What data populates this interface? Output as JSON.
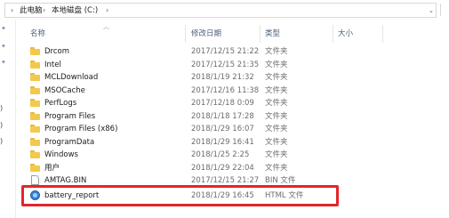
{
  "address": {
    "this_pc": "此电脑",
    "drive": "本地磁盘 (C:)"
  },
  "columns": {
    "name": "名称",
    "date": "修改日期",
    "type": "类型",
    "size": "大小"
  },
  "rows": [
    {
      "name": "Drcom",
      "date": "2017/12/15 21:22",
      "type": "文件夹",
      "size": "",
      "icon": "folder-icon"
    },
    {
      "name": "Intel",
      "date": "2017/12/15 21:35",
      "type": "文件夹",
      "size": "",
      "icon": "folder-icon"
    },
    {
      "name": "MCLDownload",
      "date": "2018/1/19 21:32",
      "type": "文件夹",
      "size": "",
      "icon": "folder-icon"
    },
    {
      "name": "MSOCache",
      "date": "2017/12/16 11:38",
      "type": "文件夹",
      "size": "",
      "icon": "folder-icon"
    },
    {
      "name": "PerfLogs",
      "date": "2017/12/18 0:09",
      "type": "文件夹",
      "size": "",
      "icon": "folder-icon"
    },
    {
      "name": "Program Files",
      "date": "2018/1/18 17:28",
      "type": "文件夹",
      "size": "",
      "icon": "folder-icon"
    },
    {
      "name": "Program Files (x86)",
      "date": "2018/1/29 16:07",
      "type": "文件夹",
      "size": "",
      "icon": "folder-icon"
    },
    {
      "name": "ProgramData",
      "date": "2018/1/29 16:41",
      "type": "文件夹",
      "size": "",
      "icon": "folder-icon"
    },
    {
      "name": "Windows",
      "date": "2018/1/25 2:25",
      "type": "文件夹",
      "size": "",
      "icon": "folder-icon"
    },
    {
      "name": "用户",
      "date": "2018/1/29 22:04",
      "type": "文件夹",
      "size": "",
      "icon": "folder-icon"
    },
    {
      "name": "AMTAG.BIN",
      "date": "2017/12/15 21:27",
      "type": "BIN 文件",
      "size": "",
      "icon": "file-icon"
    },
    {
      "name": "battery_report",
      "date": "2018/1/29 16:45",
      "type": "HTML 文件",
      "size": "",
      "icon": "html-file-icon"
    }
  ],
  "left_fragments": [
    ")",
    ")",
    ")"
  ],
  "colors": {
    "folder": "#f2c94c",
    "highlight_border": "#e3252b",
    "header_text": "#4c607a"
  }
}
